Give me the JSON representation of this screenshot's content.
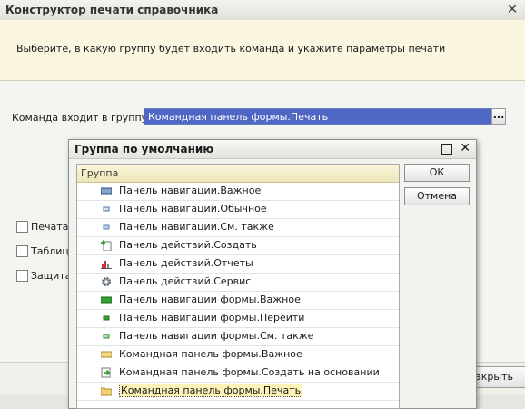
{
  "main": {
    "title": "Конструктор печати справочника",
    "info": "Выберите, в какую группу будет входить команда и укажите параметры печати",
    "group_label": "Команда входит в группу:",
    "group_value": "Командная панель формы.Печать",
    "select_button": "...",
    "checkboxes": [
      "Печатать",
      "Таблица",
      "Защита"
    ],
    "close_button_partial": "Закрыть"
  },
  "dialog": {
    "title": "Группа по умолчанию",
    "column_header": "Группа",
    "ok": "ОК",
    "cancel": "Отмена",
    "rows": [
      {
        "label": "Панель навигации.Важное",
        "icon": "navigation-important-icon"
      },
      {
        "label": "Панель навигации.Обычное",
        "icon": "navigation-normal-icon"
      },
      {
        "label": "Панель навигации.См. также",
        "icon": "navigation-see-also-icon"
      },
      {
        "label": "Панель действий.Создать",
        "icon": "create-document-icon"
      },
      {
        "label": "Панель действий.Отчеты",
        "icon": "reports-chart-icon"
      },
      {
        "label": "Панель действий.Сервис",
        "icon": "service-gear-icon"
      },
      {
        "label": "Панель навигации формы.Важное",
        "icon": "form-navigation-important-icon"
      },
      {
        "label": "Панель навигации формы.Перейти",
        "icon": "form-navigation-go-icon"
      },
      {
        "label": "Панель навигации формы.См. также",
        "icon": "form-navigation-see-also-icon"
      },
      {
        "label": "Командная панель формы.Важное",
        "icon": "command-bar-important-icon"
      },
      {
        "label": "Командная панель формы.Создать на основании",
        "icon": "create-based-on-icon"
      },
      {
        "label": "Командная панель формы.Печать",
        "icon": "print-folder-icon",
        "selected": true
      }
    ]
  }
}
